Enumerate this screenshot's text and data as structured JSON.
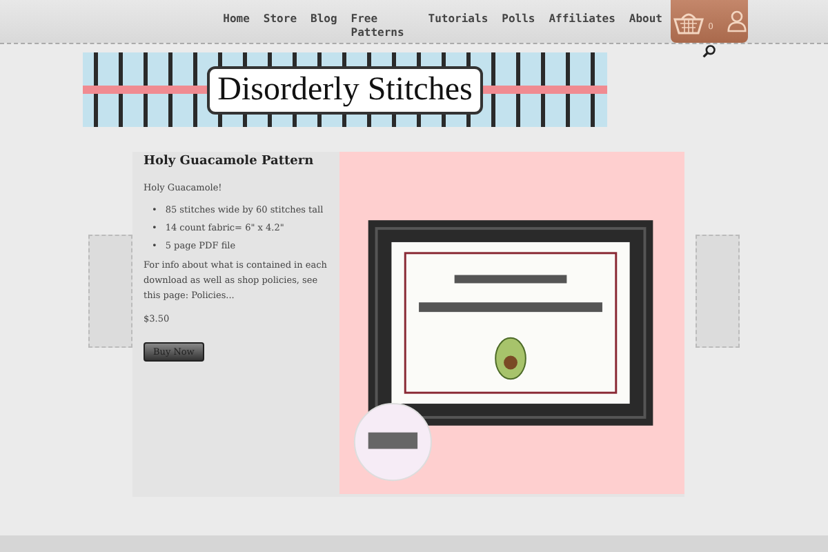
{
  "nav": {
    "items": [
      {
        "label": "Home"
      },
      {
        "label": "Store"
      },
      {
        "label": "Blog"
      },
      {
        "label": "Free Patterns"
      },
      {
        "label": "Tutorials"
      },
      {
        "label": "Polls"
      },
      {
        "label": "Affiliates"
      },
      {
        "label": "About"
      }
    ],
    "cart_count": "0"
  },
  "banner": {
    "title": "Disorderly Stitches"
  },
  "product": {
    "title": "Holy Guacamole Pattern",
    "intro": "Holy Guacamole!",
    "bullet": "•",
    "features": [
      "85 stitches wide by 60 stitches tall",
      "14 count fabric= 6\" x 4.2\"",
      "5 page PDF file"
    ],
    "info": "For info about what is contained in each download as well as shop policies, see this page: ",
    "info_link": "Policies...",
    "price": "$3.50",
    "buy": "Buy Now"
  }
}
